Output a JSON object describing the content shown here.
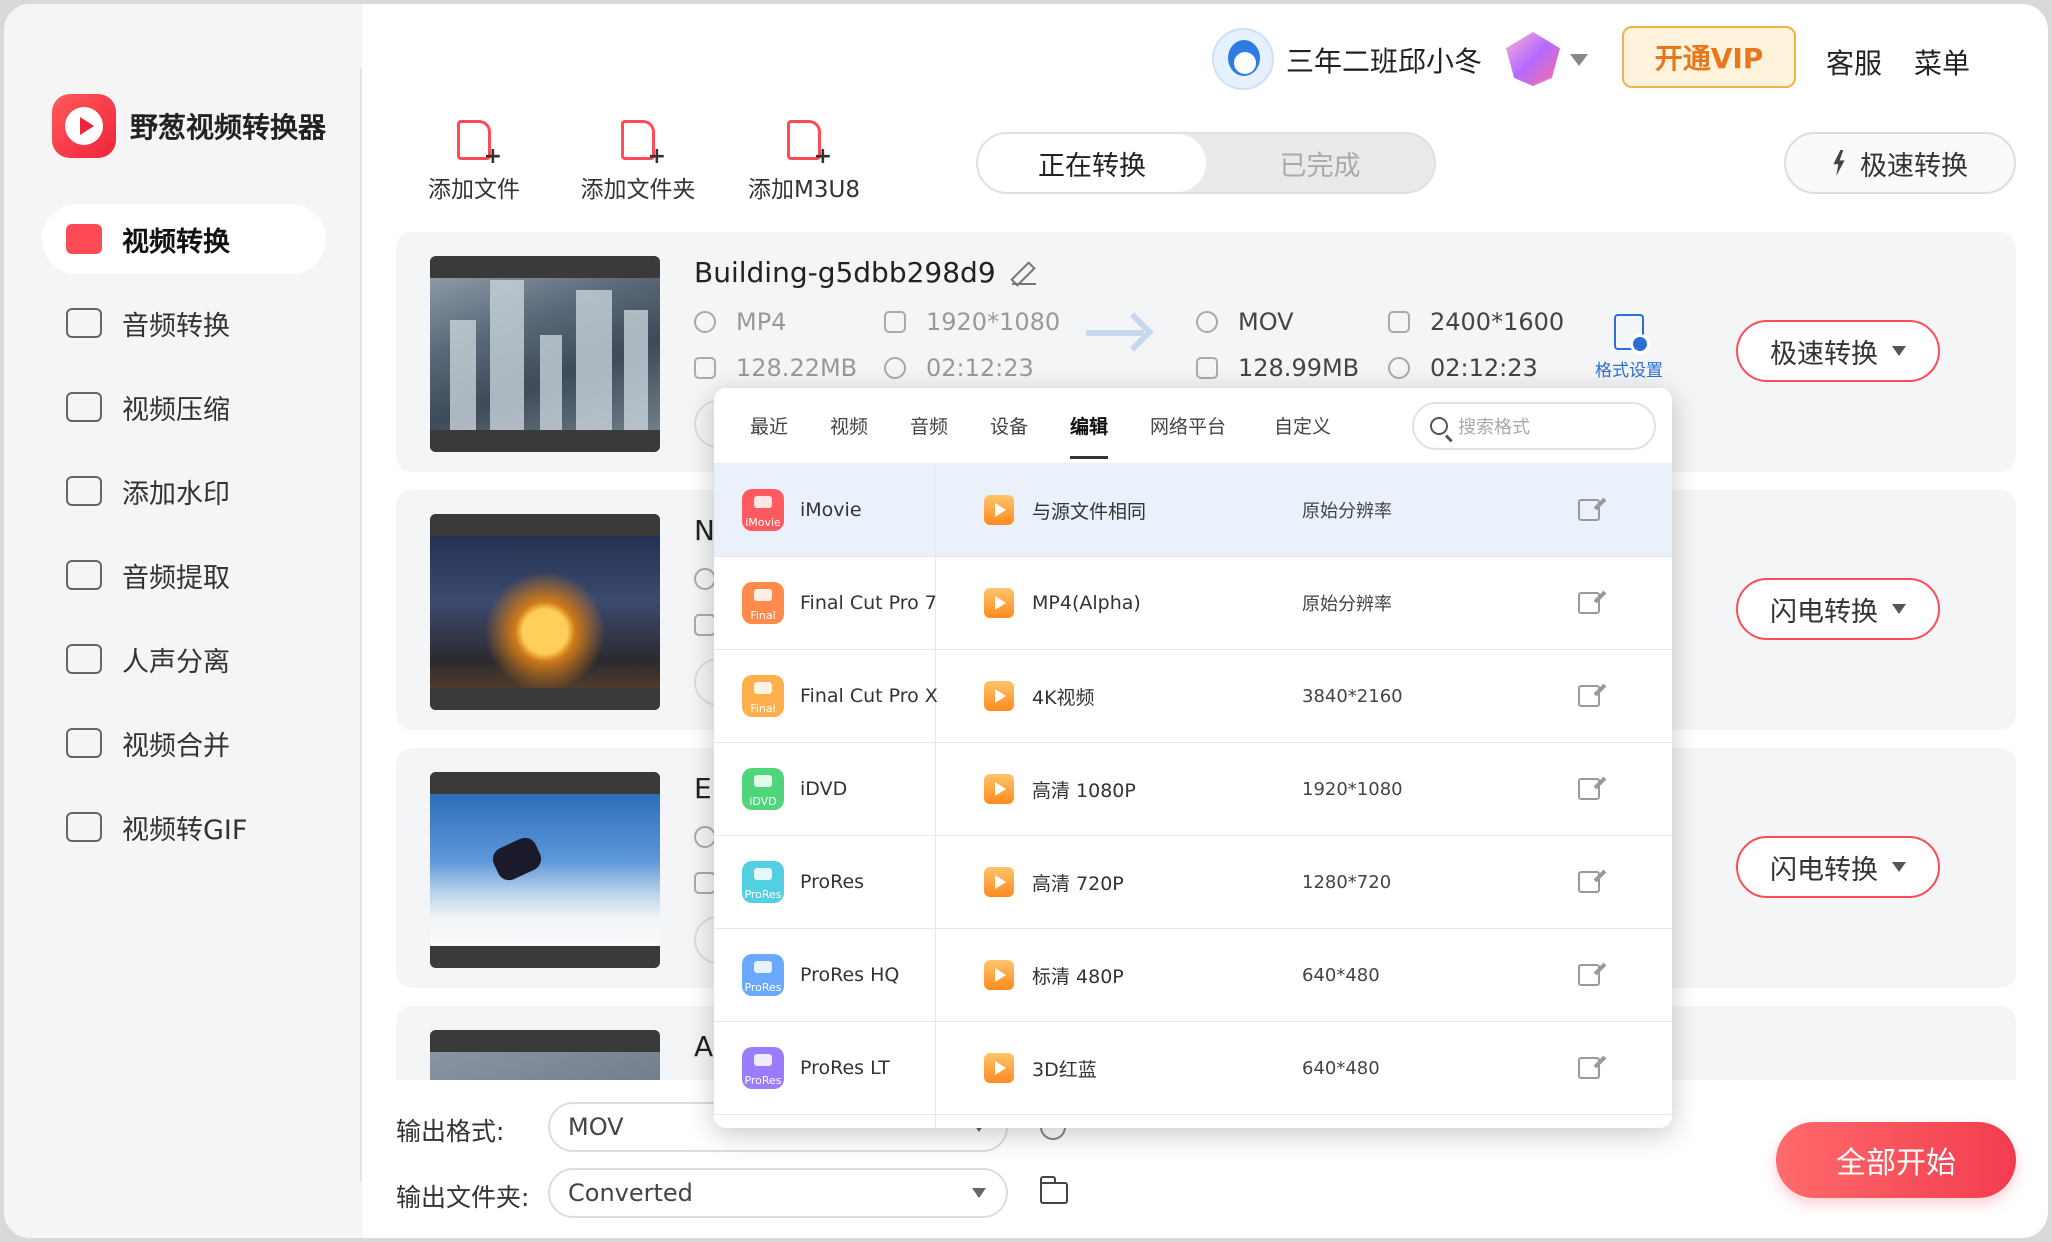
{
  "app": {
    "name": "野葱视频转换器",
    "accent": "#ff4b55"
  },
  "header": {
    "username": "三年二班邱小冬",
    "vip_label": "开通VIP",
    "service_label": "客服",
    "menu_label": "菜单"
  },
  "sidebar": {
    "items": [
      {
        "label": "视频转换",
        "icon": "video-convert-icon",
        "active": true
      },
      {
        "label": "音频转换",
        "icon": "audio-convert-icon"
      },
      {
        "label": "视频压缩",
        "icon": "video-compress-icon"
      },
      {
        "label": "添加水印",
        "icon": "watermark-icon"
      },
      {
        "label": "音频提取",
        "icon": "audio-extract-icon"
      },
      {
        "label": "人声分离",
        "icon": "vocal-separate-icon"
      },
      {
        "label": "视频合并",
        "icon": "video-merge-icon"
      },
      {
        "label": "视频转GIF",
        "icon": "gif-icon"
      }
    ]
  },
  "toolbar": {
    "add_file": "添加文件",
    "add_folder": "添加文件夹",
    "add_m3u8": "添加M3U8",
    "tab_converting": "正在转换",
    "tab_done": "已完成",
    "speed_convert": "极速转换"
  },
  "files": [
    {
      "name": "Building-g5dbb298d9",
      "src_format": "MP4",
      "src_resolution": "1920*1080",
      "src_size": "128.22MB",
      "src_duration": "02:12:23",
      "dst_format": "MOV",
      "dst_resolution": "2400*1600",
      "dst_size": "128.99MB",
      "dst_duration": "02:12:23",
      "format_settings": "格式设置",
      "convert_button": "极速转换"
    },
    {
      "initial": "N",
      "convert_button": "闪电转换"
    },
    {
      "initial": "E",
      "convert_button": "闪电转换"
    },
    {
      "initial": "A"
    }
  ],
  "bottom": {
    "output_format_label": "输出格式:",
    "output_format_value": "MOV",
    "output_folder_label": "输出文件夹:",
    "output_folder_value": "Converted",
    "start_all": "全部开始"
  },
  "format_popup": {
    "tabs": [
      "最近",
      "视频",
      "音频",
      "设备",
      "编辑",
      "网络平台",
      "自定义"
    ],
    "active_tab": "编辑",
    "search_placeholder": "搜索格式",
    "apps": [
      {
        "name": "iMovie",
        "badge": "iMovie",
        "color": "#ff5a5f"
      },
      {
        "name": "Final Cut Pro 7",
        "badge": "Final",
        "color": "#ff8a4c"
      },
      {
        "name": "Final Cut Pro X",
        "badge": "Final",
        "color": "#ffb04c"
      },
      {
        "name": "iDVD",
        "badge": "iDVD",
        "color": "#4fd67a"
      },
      {
        "name": "ProRes",
        "badge": "ProRes",
        "color": "#52cfe0"
      },
      {
        "name": "ProRes HQ",
        "badge": "ProRes",
        "color": "#6aa9ff"
      },
      {
        "name": "ProRes LT",
        "badge": "ProRes",
        "color": "#9a7cff"
      }
    ],
    "presets": [
      {
        "name": "与源文件相同",
        "resolution": "原始分辨率"
      },
      {
        "name": "MP4(Alpha)",
        "resolution": "原始分辨率"
      },
      {
        "name": "4K视频",
        "resolution": "3840*2160"
      },
      {
        "name": "高清 1080P",
        "resolution": "1920*1080"
      },
      {
        "name": "高清 720P",
        "resolution": "1280*720"
      },
      {
        "name": "标清 480P",
        "resolution": "640*480"
      },
      {
        "name": "3D红蓝",
        "resolution": "640*480"
      }
    ]
  }
}
